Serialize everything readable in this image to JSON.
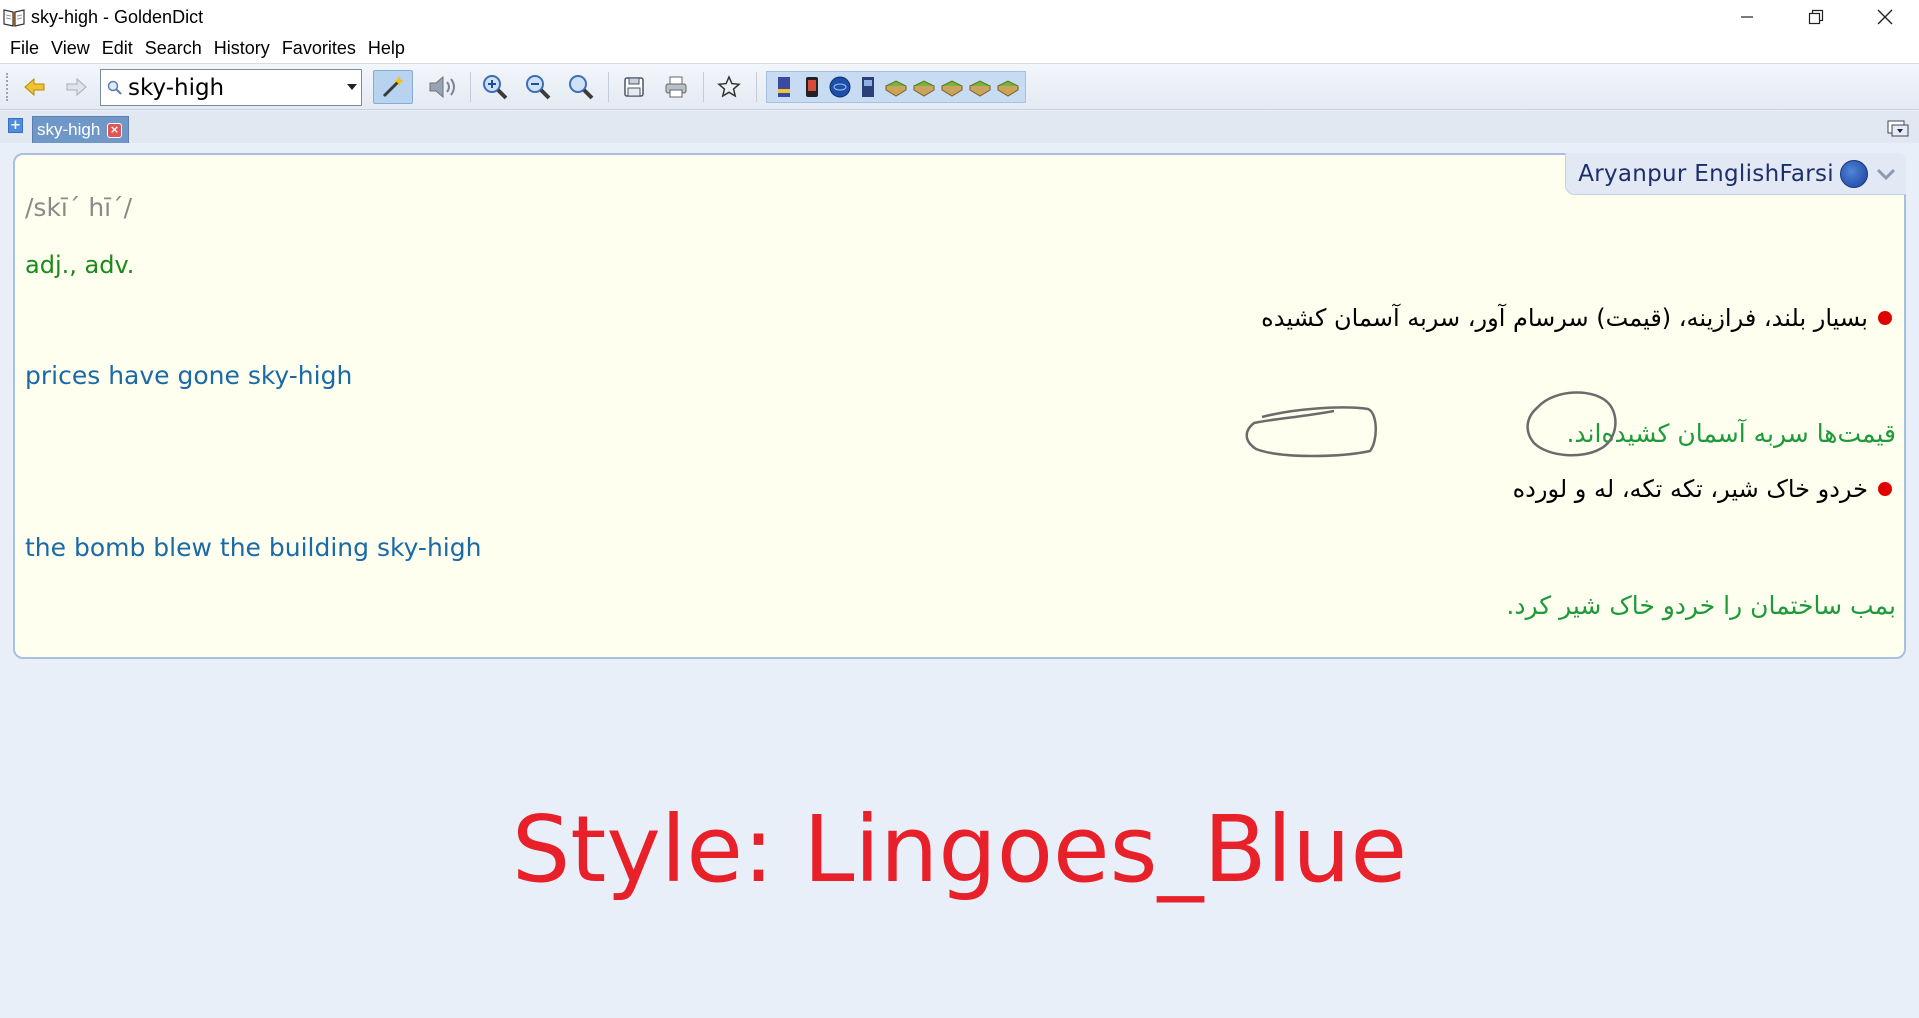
{
  "window": {
    "title": "sky-high - GoldenDict"
  },
  "menu": [
    "File",
    "View",
    "Edit",
    "Search",
    "History",
    "Favorites",
    "Help"
  ],
  "toolbar": {
    "search_value": "sky-high",
    "icons": [
      "back-icon",
      "forward-icon",
      "magic-wand-icon",
      "speaker-icon",
      "zoom-in-icon",
      "zoom-out-icon",
      "zoom-reset-icon",
      "save-icon",
      "print-icon",
      "favorites-star-icon"
    ],
    "dictionary_icons": [
      "dict-book-icon",
      "dict-phone-icon",
      "dict-globe-icon",
      "dict-blue-book-icon",
      "dict-green-book-icon",
      "dict-green-book-icon",
      "dict-green-book-icon",
      "dict-green-book-icon",
      "dict-green-book-icon"
    ]
  },
  "tabs": [
    {
      "label": "sky-high"
    }
  ],
  "article": {
    "dictionary_name": "Aryanpur EnglishFarsi",
    "pronunciation": "/skī´ hī´/",
    "part_of_speech": "adj., adv.",
    "definitions": [
      {
        "farsi": "بسیار بلند، فرازینه، (قیمت) سرسام آور، سربه آسمان کشیده",
        "example_en": "prices have gone sky-high",
        "example_fa": "قیمت‌ها سربه آسمان کشیده‌اند."
      },
      {
        "farsi": "خردو خاک شیر، تکه تکه، له و لورده",
        "example_en": "the bomb blew the building sky-high",
        "example_fa": "بمب ساختمان را خردو خاک شیر کرد."
      }
    ]
  },
  "caption": "Style: Lingoes_Blue",
  "colors": {
    "caption": "#e8202a",
    "pos": "#1a8a1a",
    "example_en": "#1a6aa8",
    "example_fa": "#1d9a3a",
    "bullet": "#e00000",
    "article_bg": "#fffff0"
  }
}
